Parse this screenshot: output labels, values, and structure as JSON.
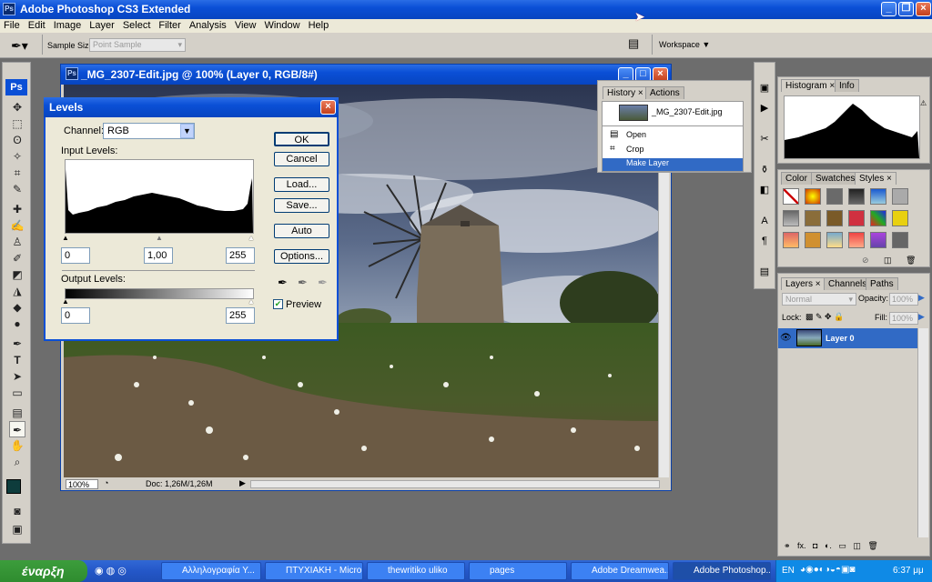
{
  "app": {
    "title": "Adobe Photoshop CS3 Extended",
    "icon": "Ps"
  },
  "menu": [
    "File",
    "Edit",
    "Image",
    "Layer",
    "Select",
    "Filter",
    "Analysis",
    "View",
    "Window",
    "Help"
  ],
  "options": {
    "sample_size_label": "Sample Size:",
    "sample_size_value": "Point Sample",
    "workspace_label": "Workspace"
  },
  "document": {
    "title": "_MG_2307-Edit.jpg @ 100% (Layer 0, RGB/8#)",
    "zoom": "100%",
    "doc_info": "Doc: 1,26M/1,26M"
  },
  "levels": {
    "title": "Levels",
    "channel_label": "Channel:",
    "channel_value": "RGB",
    "input_label": "Input Levels:",
    "input_black": "0",
    "input_gamma": "1,00",
    "input_white": "255",
    "output_label": "Output Levels:",
    "output_black": "0",
    "output_white": "255",
    "ok": "OK",
    "cancel": "Cancel",
    "load": "Load...",
    "save": "Save...",
    "auto": "Auto",
    "options": "Options...",
    "preview": "Preview",
    "preview_checked": true
  },
  "history": {
    "tabs": [
      "History",
      "Actions"
    ],
    "snapshot": "_MG_2307-Edit.jpg",
    "items": [
      "Open",
      "Crop",
      "Make Layer"
    ]
  },
  "histogram": {
    "tabs": [
      "Histogram",
      "Info"
    ]
  },
  "styles": {
    "tabs": [
      "Color",
      "Swatches",
      "Styles"
    ]
  },
  "layers": {
    "tabs": [
      "Layers",
      "Channels",
      "Paths"
    ],
    "blend_mode": "Normal",
    "opacity_label": "Opacity:",
    "opacity": "100%",
    "lock_label": "Lock:",
    "fill_label": "Fill:",
    "fill": "100%",
    "layer_name": "Layer 0"
  },
  "taskbar": {
    "start": "έναρξη",
    "tasks": [
      "Αλληλογραφία Υ...",
      "ΠΤΥΧΙΑΚΗ - Micro...",
      "thewritiko uliko",
      "pages",
      "Adobe Dreamwea...",
      "Adobe Photoshop..."
    ],
    "lang": "EN",
    "time": "6:37 μμ"
  },
  "colors": {
    "titlebar": "#0a4fd6",
    "panel": "#d4d0c8",
    "selected_layer": "#316ac5",
    "foreground": "#0e3c3c"
  }
}
